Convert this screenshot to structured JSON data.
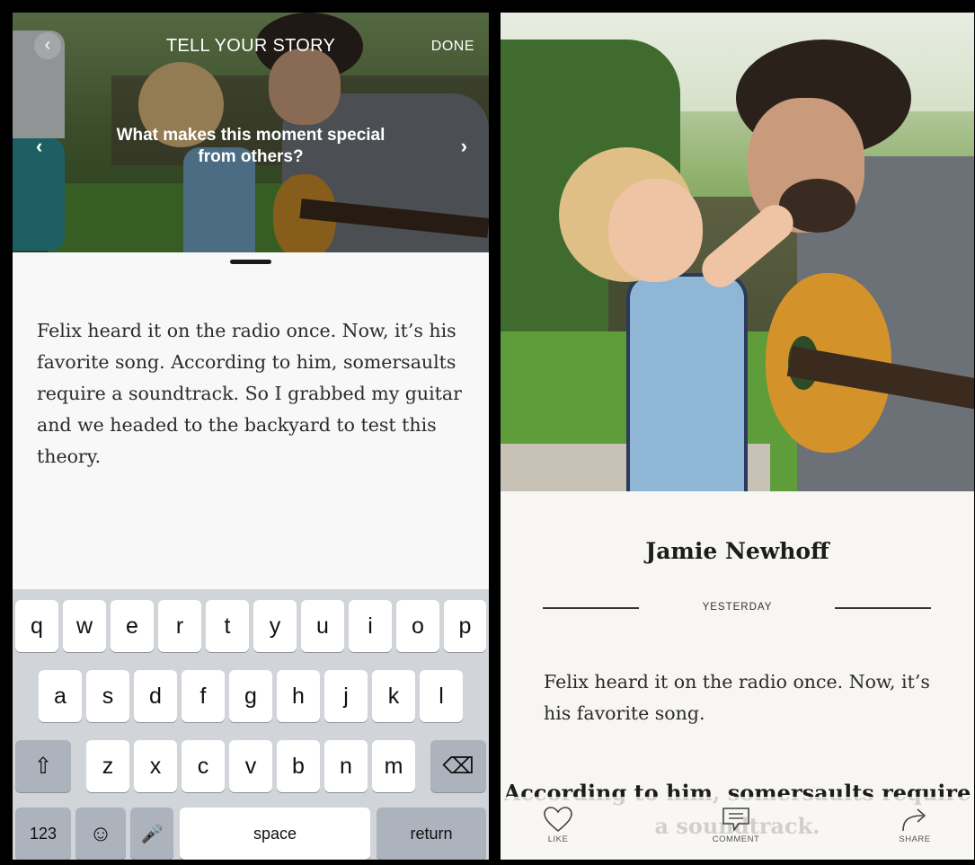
{
  "editor": {
    "title": "TELL YOUR STORY",
    "back": "‹",
    "done": "DONE",
    "prompt": "What makes this moment special from others?",
    "prev": "‹",
    "next": "›",
    "story": "Felix heard it on the radio once. Now, it’s his favorite song. According to him, somersaults require a soundtrack. So I grabbed my guitar and we headed to the backyard to test this theory."
  },
  "keyboard": {
    "row1": [
      "q",
      "w",
      "e",
      "r",
      "t",
      "y",
      "u",
      "i",
      "o",
      "p"
    ],
    "row2": [
      "a",
      "s",
      "d",
      "f",
      "g",
      "h",
      "j",
      "k",
      "l"
    ],
    "row3": [
      "z",
      "x",
      "c",
      "v",
      "b",
      "n",
      "m"
    ],
    "shift": "⇧",
    "delete": "⌫",
    "numbers": "123",
    "emoji": "☺",
    "mic": "🎤",
    "space": "space",
    "return": "return"
  },
  "post": {
    "author": "Jamie Newhoff",
    "date": "YESTERDAY",
    "text": "Felix heard it on the radio once. Now, it’s his favorite song.",
    "pull_quote": "According to him, somersaults require a soundtrack.",
    "actions": [
      {
        "label": "LIKE",
        "icon": "heart-icon"
      },
      {
        "label": "COMMENT",
        "icon": "comment-icon"
      },
      {
        "label": "SHARE",
        "icon": "share-icon"
      }
    ]
  }
}
